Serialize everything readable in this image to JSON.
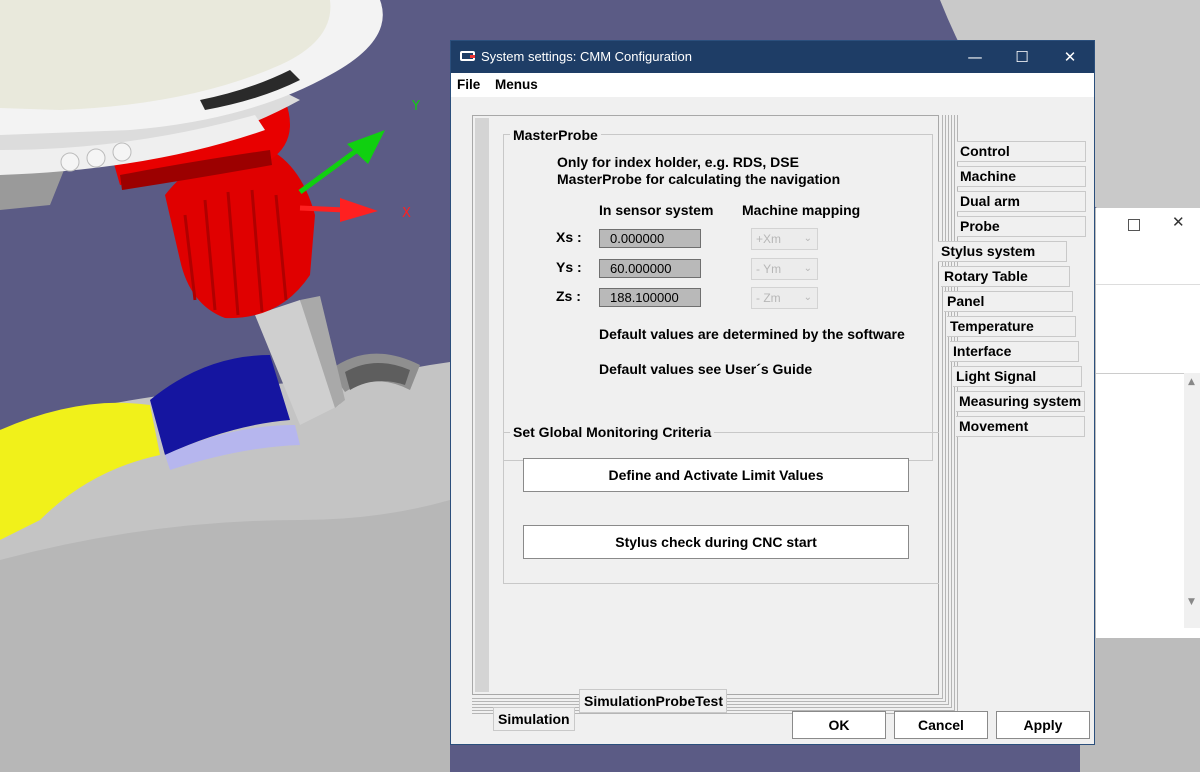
{
  "window": {
    "title": "System settings: CMM Configuration",
    "minimize": "—",
    "maximize": "☐",
    "close": "✕"
  },
  "menu": [
    "File",
    "Menus"
  ],
  "masterprobe": {
    "group_label": "MasterProbe",
    "line1": "Only for index holder, e.g. RDS, DSE",
    "line2": "MasterProbe for calculating the navigation",
    "col_sensor": "In sensor system",
    "col_mapping": "Machine mapping",
    "rows": [
      {
        "label": "Xs :",
        "value": "0.000000",
        "mapping": "+Xm"
      },
      {
        "label": "Ys :",
        "value": "60.000000",
        "mapping": "- Ym"
      },
      {
        "label": "Zs :",
        "value": "188.100000",
        "mapping": "- Zm"
      }
    ],
    "note1": "Default values are determined by the software",
    "note2": "Default values see User´s Guide"
  },
  "monitoring": {
    "group_label": "Set Global Monitoring Criteria",
    "btn_limits": "Define and Activate Limit Values",
    "btn_stylus": "Stylus check during CNC start"
  },
  "side_tabs": [
    "Control",
    "Machine",
    "Dual arm",
    "Probe",
    "Stylus system",
    "Rotary Table",
    "Panel",
    "Temperature",
    "Interface",
    "Light Signal",
    "Measuring system",
    "Movement"
  ],
  "bottom_tabs": [
    "SimulationProbeTest",
    "Simulation"
  ],
  "footer": {
    "ok": "OK",
    "cancel": "Cancel",
    "apply": "Apply"
  },
  "viewport": {
    "axis_y": "Y",
    "axis_x": "X"
  },
  "background_window": {
    "maximize": "☐",
    "close": "✕",
    "scroll_up": "▲",
    "scroll_down": "▼"
  }
}
